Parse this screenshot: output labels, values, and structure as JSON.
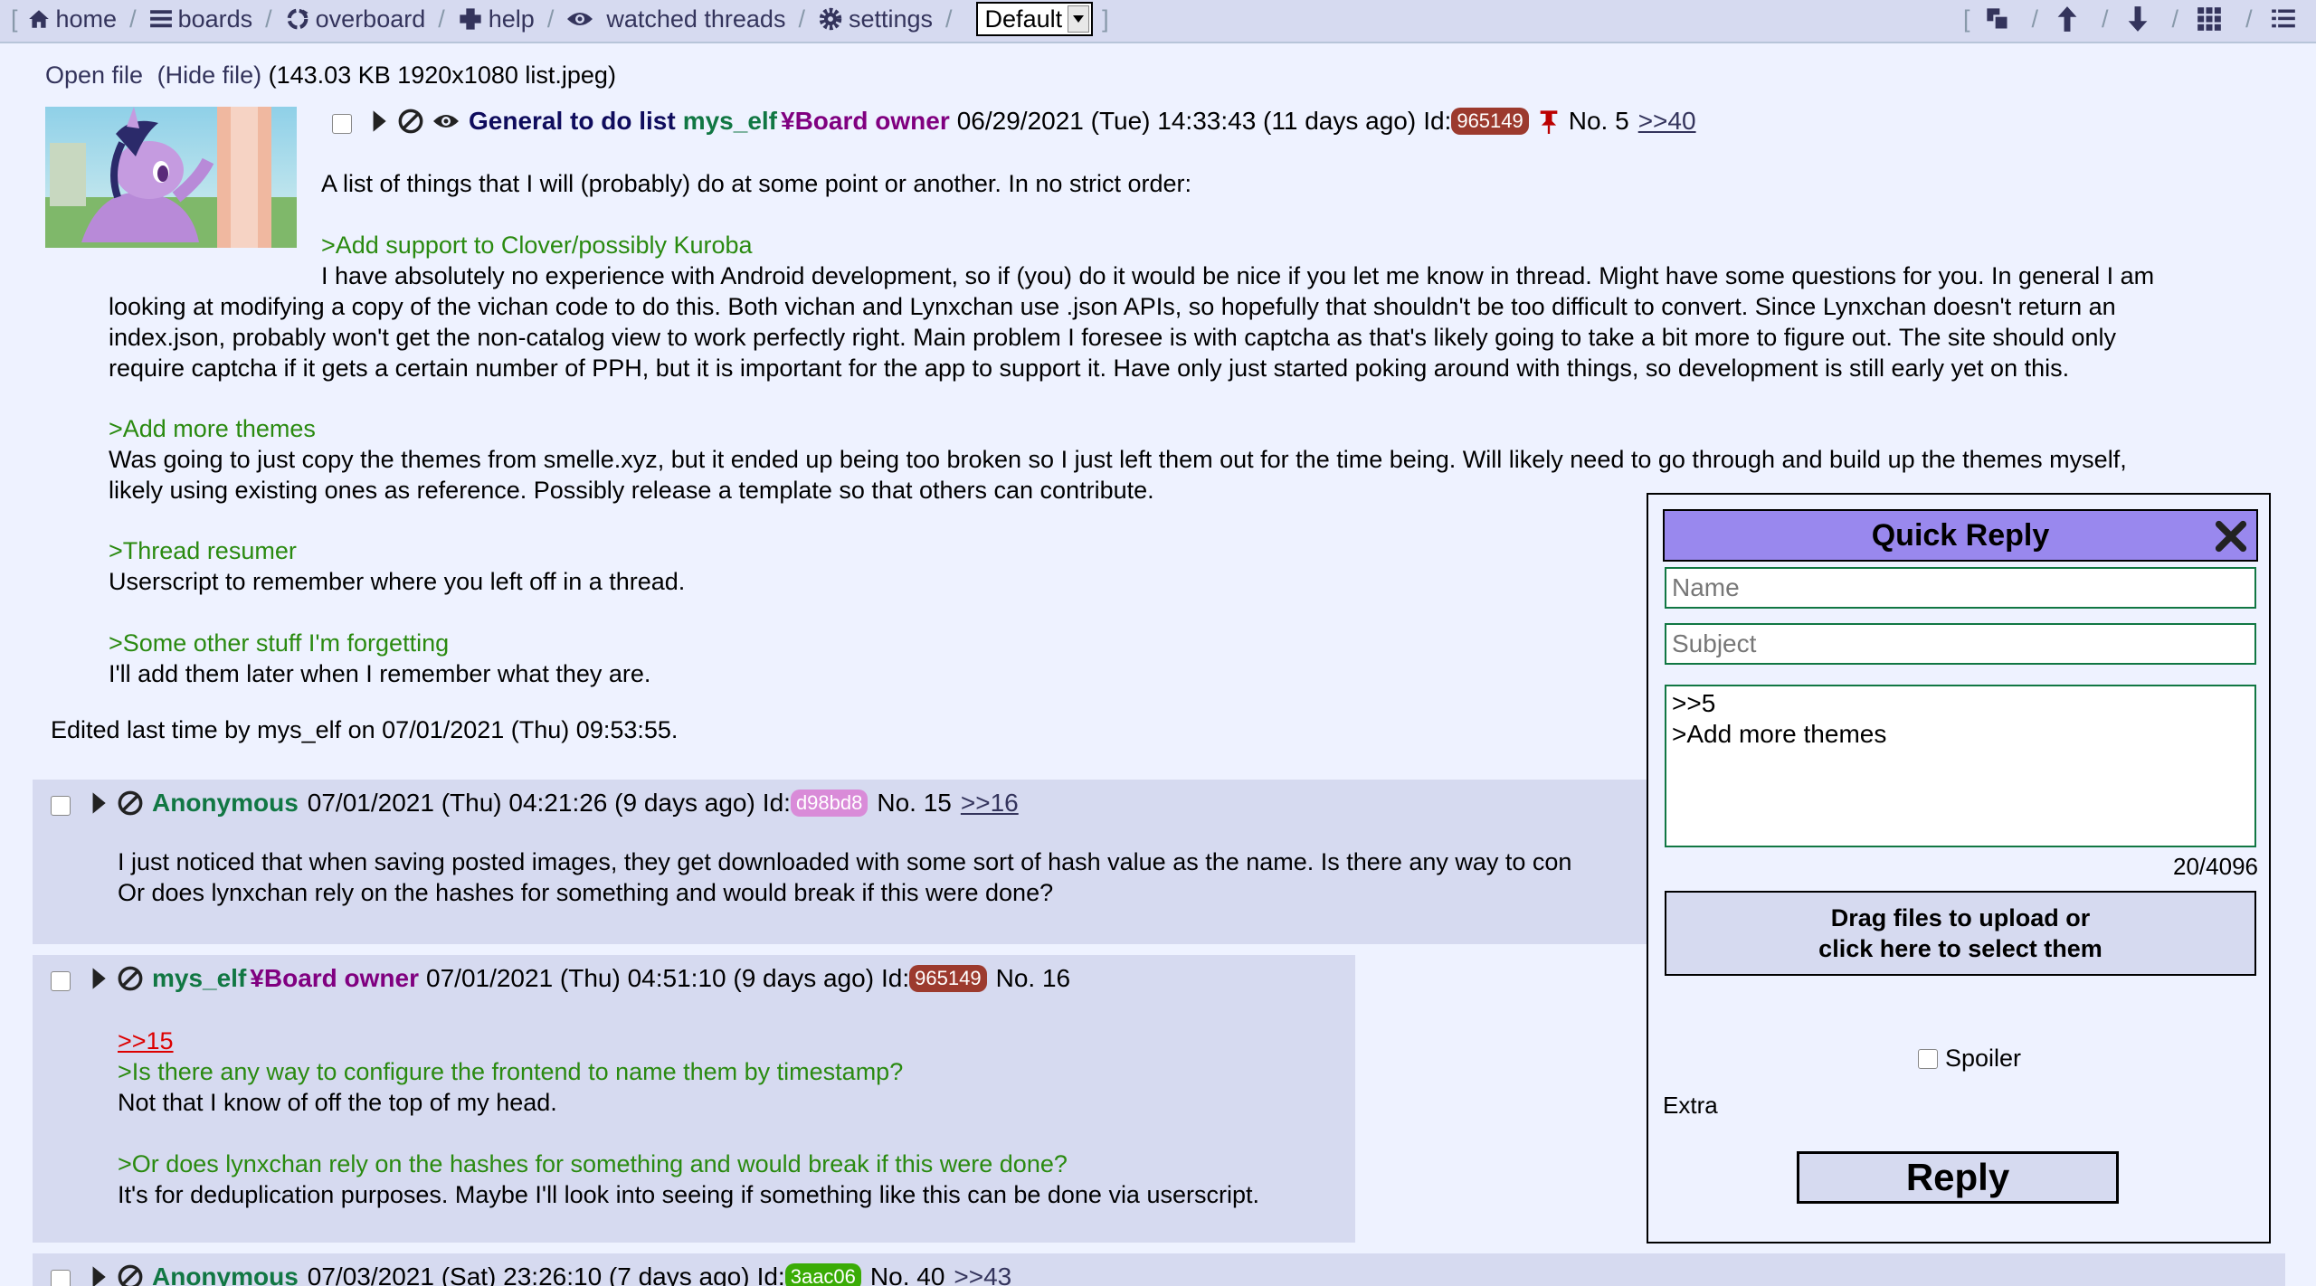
{
  "nav": {
    "home": "home",
    "boards": "boards",
    "overboard": "overboard",
    "help": "help",
    "watched": "watched threads",
    "settings": "settings",
    "theme": "Default"
  },
  "op": {
    "open_file": "Open file",
    "hide_file": "(Hide file)",
    "file_meta": "(143.03 KB 1920x1080",
    "file_name": "list.jpeg)",
    "subject": "General to do list",
    "name": "mys_elf",
    "capcode": "Board owner",
    "date": "06/29/2021 (Tue) 14:33:43 (11 days ago)",
    "id_label": "Id:",
    "id": "965149",
    "no": "No. 5",
    "backlink": ">>40",
    "intro": "A list of things that I will (probably) do at some point or another. In no strict order:",
    "g1": ">Add support to Clover/possibly Kuroba",
    "p1a": "I have absolutely no experience with Android development, so if (you) do it would be nice if you let me know in thread. Might have some questions for you. In general I am",
    "p1b": "looking at modifying a copy of the vichan code to do this. Both vichan and Lynxchan use .json APIs, so hopefully that shouldn't be too difficult to convert. Since Lynxchan doesn't return an",
    "p1c": "index.json, probably won't get the non-catalog view to work perfectly right. Main problem I foresee is with captcha as that's likely going to take a bit more to figure out. The site should only",
    "p1d": "require captcha if it gets a certain number of PPH, but it is important for the app to support it. Have only just started poking around with things, so development is still early yet on this.",
    "g2": ">Add more themes",
    "p2a": "Was going to just copy the themes from smelle.xyz, but it ended up being too broken so I just left them out for the time being. Will likely need to go through and build up the themes myself,",
    "p2b": "likely using existing ones as reference. Possibly release a template so that others can contribute.",
    "g3": ">Thread resumer",
    "p3": "Userscript to remember where you left off in a thread.",
    "g4": ">Some other stuff I'm forgetting",
    "p4": "I'll add them later when I remember what they are.",
    "edited": "Edited last time by mys_elf on 07/01/2021 (Thu) 09:53:55."
  },
  "reply15": {
    "name": "Anonymous",
    "date": "07/01/2021 (Thu) 04:21:26 (9 days ago)",
    "id_label": "Id:",
    "id": "d98bd8",
    "no": "No. 15",
    "backlink": ">>16",
    "l1": "I just noticed that when saving posted images, they get downloaded with some sort of hash value as the name. Is there any way to con",
    "l2": "Or does lynxchan rely on the hashes for something and would break if this were done?"
  },
  "reply16": {
    "name": "mys_elf",
    "capcode": "Board owner",
    "date": "07/01/2021 (Thu) 04:51:10 (9 days ago)",
    "id_label": "Id:",
    "id": "965149",
    "no": "No. 16",
    "quote": ">>15",
    "g1": ">Is there any way to configure the frontend to name them by timestamp?",
    "l1": "Not that I know of off the top of my head.",
    "g2": ">Or does lynxchan rely on the hashes for something and would break if this were done?",
    "l2": "It's for deduplication purposes. Maybe I'll look into seeing if something like this can be done via userscript."
  },
  "reply40": {
    "name": "Anonymous",
    "date": "07/03/2021 (Sat) 23:26:10 (7 days ago)",
    "id_label": "Id:",
    "id": "3aac06",
    "no": "No. 40",
    "backlink": ">>43"
  },
  "quick_reply": {
    "title": "Quick Reply",
    "name_placeholder": "Name",
    "subject_placeholder": "Subject",
    "message": ">>5\n>Add more themes",
    "counter": "20/4096",
    "drop_line1": "Drag files to upload or",
    "drop_line2": "click here to select them",
    "spoiler": "Spoiler",
    "extra": "Extra",
    "reply_button": "Reply"
  },
  "colors": {
    "id_965149": "#9c3a2e",
    "id_d98bd8": "#d98bd8",
    "id_3aac06": "#3aac06",
    "qr_header": "#9988ee",
    "post_bg": "#d6daf0"
  }
}
